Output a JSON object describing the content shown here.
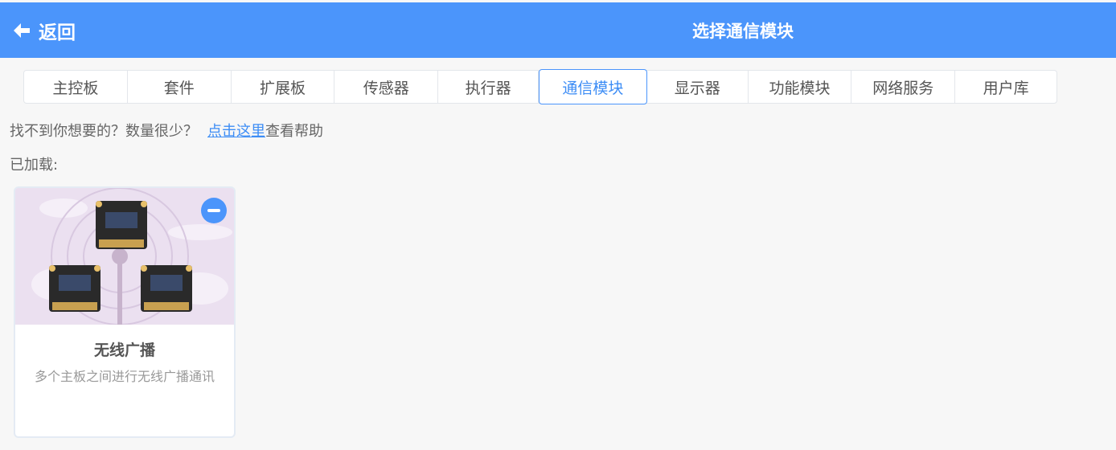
{
  "header": {
    "back_label": "返回",
    "title": "选择通信模块",
    "background": "#4b95fb"
  },
  "tabs": [
    {
      "label": "主控板",
      "active": false
    },
    {
      "label": "套件",
      "active": false
    },
    {
      "label": "扩展板",
      "active": false
    },
    {
      "label": "传感器",
      "active": false
    },
    {
      "label": "执行器",
      "active": false
    },
    {
      "label": "通信模块",
      "active": true
    },
    {
      "label": "显示器",
      "active": false
    },
    {
      "label": "功能模块",
      "active": false
    },
    {
      "label": "网络服务",
      "active": false
    },
    {
      "label": "用户库",
      "active": false
    }
  ],
  "help": {
    "text": "找不到你想要的？数量很少？",
    "link": "点击这里",
    "suffix": "查看帮助"
  },
  "loaded_label": "已加载:",
  "cards": [
    {
      "title": "无线广播",
      "description": "多个主板之间进行无线广播通讯",
      "remove_icon": "minus-circle-icon",
      "image_icon": "wireless-boards-illustration"
    }
  ],
  "colors": {
    "accent": "#4b95fb",
    "link": "#3d8df5",
    "card_bg": "#ebe0f0"
  }
}
